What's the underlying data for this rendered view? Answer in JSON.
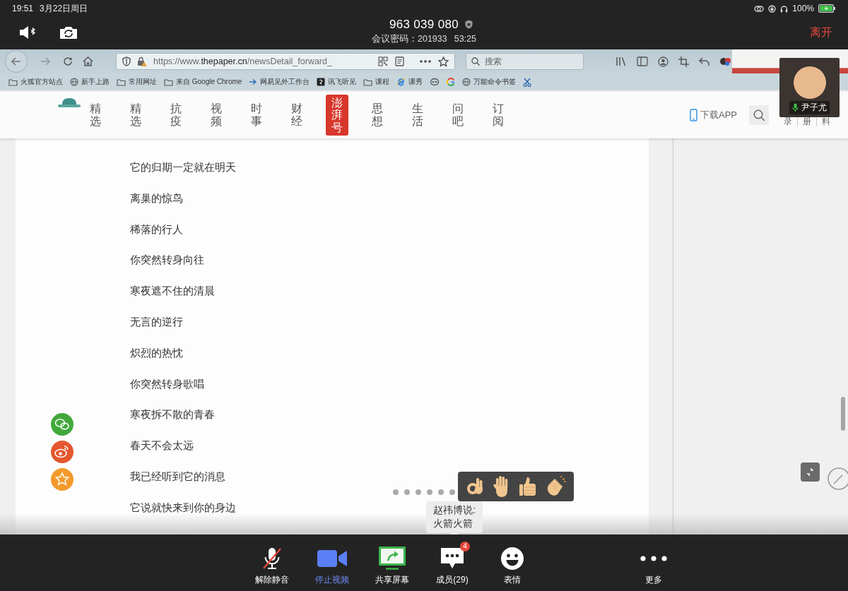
{
  "status_bar": {
    "time": "19:51",
    "date": "3月22日周日",
    "battery": "100%"
  },
  "meeting": {
    "meeting_id": "963 039 080",
    "password": "会议密码：201933",
    "duration": "53:25",
    "leave": "离开"
  },
  "browser": {
    "url": {
      "scheme": "https://www.",
      "domain": "thepaper.cn",
      "path": "/newsDetail_forward_"
    },
    "search_placeholder": "搜索",
    "bookmarks": [
      {
        "kind": "folder",
        "label": "火狐官方站点"
      },
      {
        "kind": "globe",
        "label": "新手上路"
      },
      {
        "kind": "folder",
        "label": "常用网址"
      },
      {
        "kind": "folder",
        "label": "来自 Google Chrome"
      },
      {
        "kind": "arrow",
        "label": "网易见外工作台"
      },
      {
        "kind": "square",
        "label": "讯飞听见"
      },
      {
        "kind": "folder",
        "label": "课程"
      },
      {
        "kind": "e",
        "label": "课秀"
      },
      {
        "kind": "ring"
      },
      {
        "kind": "colorring"
      },
      {
        "kind": "globe",
        "label": "万能命令书签"
      },
      {
        "kind": "scissors"
      }
    ]
  },
  "site_nav": {
    "tabs": [
      {
        "label": "精选",
        "selected": false
      },
      {
        "label": "精选",
        "selected": false
      },
      {
        "label": "抗疫",
        "selected": false
      },
      {
        "label": "视频",
        "selected": false
      },
      {
        "label": "时事",
        "selected": false
      },
      {
        "label": "财经",
        "selected": false
      },
      {
        "label": "澎湃号",
        "selected": true
      },
      {
        "label": "思想",
        "selected": false
      },
      {
        "label": "生活",
        "selected": false
      },
      {
        "label": "问吧",
        "selected": false
      },
      {
        "label": "订阅",
        "selected": false
      }
    ],
    "download_app": "下载APP",
    "cut_links": [
      "录",
      "册",
      "料"
    ]
  },
  "video_tile": {
    "name": "尹子尤",
    "mic_on": true
  },
  "article": {
    "lines": [
      "它的归期一定就在明天",
      "离巢的惊鸟",
      "稀落的行人",
      "你突然转身向往",
      "寒夜遮不住的清晨",
      "无言的逆行",
      "炽烈的热忱",
      "你突然转身歌唱",
      "寒夜拆不散的青春",
      "春天不会太远",
      "我已经听到它的消息",
      "它说就快来到你的身边"
    ]
  },
  "share_buttons": [
    {
      "kind": "wechat"
    },
    {
      "kind": "weibo"
    },
    {
      "kind": "favorite"
    }
  ],
  "reactions": [
    {
      "kind": "ok"
    },
    {
      "kind": "raised-hand"
    },
    {
      "kind": "thumbs-up"
    },
    {
      "kind": "clap"
    }
  ],
  "chat_bubble": {
    "sender": "赵祎博说:",
    "message": "火箭火箭"
  },
  "toolbar": [
    {
      "kind": "mic",
      "label": "解除静音",
      "muted": true
    },
    {
      "kind": "video",
      "label": "停止视频",
      "on": true
    },
    {
      "kind": "share",
      "label": "共享屏幕"
    },
    {
      "kind": "members",
      "label": "成员(29)",
      "badge": "4"
    },
    {
      "kind": "emoji",
      "label": "表情"
    },
    {
      "kind": "more",
      "label": "更多"
    }
  ]
}
